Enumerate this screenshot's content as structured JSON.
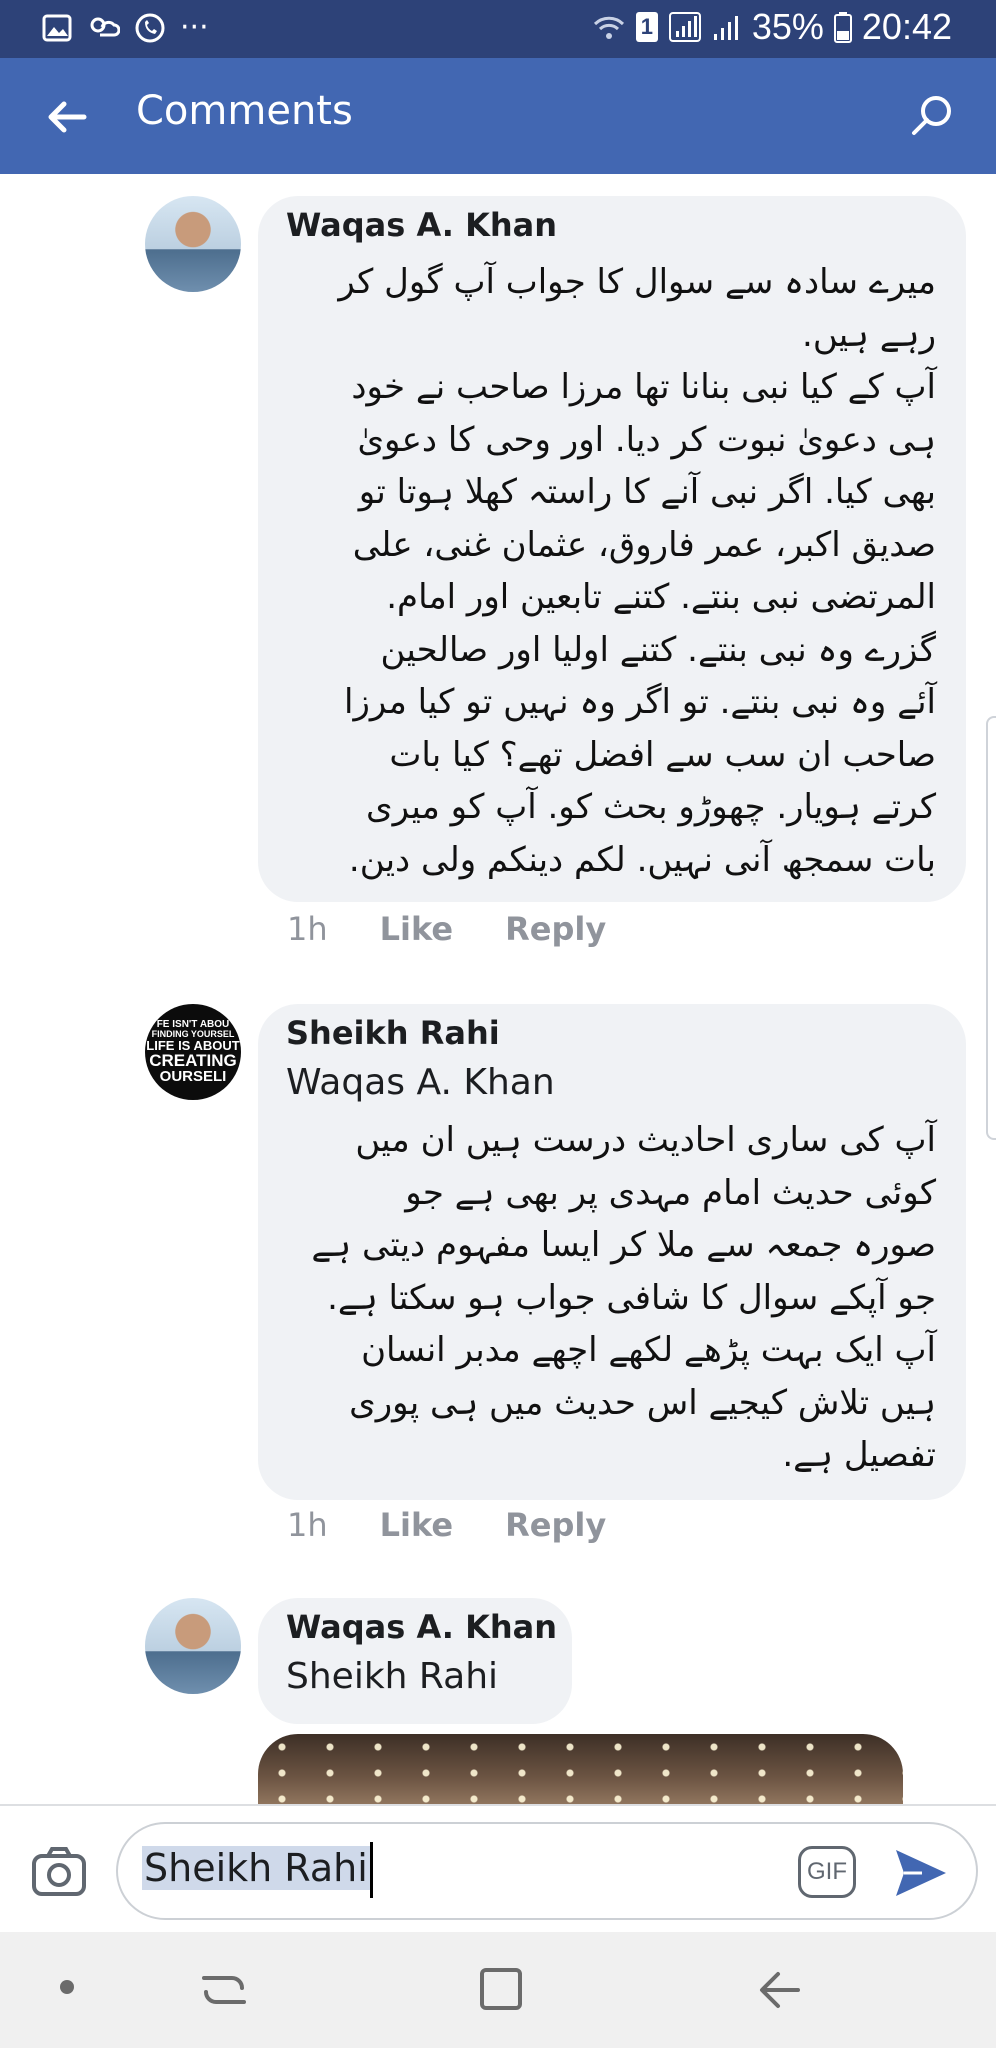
{
  "status_bar": {
    "sim_badge": "1",
    "battery": "35%",
    "time": "20:42",
    "left_icons": [
      "gallery-icon",
      "weather-icon",
      "call-icon",
      "more-dots-icon"
    ],
    "more": "···"
  },
  "app_bar": {
    "title": "Comments",
    "background": "#4267b2"
  },
  "comments": [
    {
      "author": "Waqas A. Khan",
      "avatar": "person-avatar",
      "lines": [
        "میرے سادہ سے سوال کا جواب آپ گول کر",
        "رہے ہیں.",
        "آپ کے کیا نبی بنانا تھا مرزا صاحب نے خود",
        "ہی دعویٰ نبوت کر دیا. اور وحی کا دعویٰ",
        "بھی کیا. اگر نبی آنے کا راستہ کھلا ہوتا تو",
        "صدیق اکبر، عمر فاروق، عثمان غنی، علی",
        "المرتضی نبی بنتے. کتنے تابعین اور امام.",
        "گزرے وہ نبی بنتے. کتنے اولیا اور صالحین",
        "آئے وہ نبی بنتے. تو اگر وہ نہیں تو کیا مرزا",
        "صاحب ان سب سے افضل تھے؟ کیا بات",
        "کرتے ہویار. چھوڑو بحث کو. آپ کو میری",
        "بات سمجھ آنی نہیں. لکم دینکم ولی دین."
      ],
      "time": "1h",
      "like": "Like",
      "reply": "Reply"
    },
    {
      "author": "Sheikh Rahi",
      "avatar_text": [
        "FE ISN'T ABOU",
        "FINDING YOURSEL",
        "LIFE IS ABOUT",
        "CREATING",
        "OURSELI"
      ],
      "mention": "Waqas A. Khan",
      "lines": [
        "آپ کی ساری احادیث درست ہیں ان میں",
        "کوئی حدیث امام مہدی پر بھی ہے جو",
        "صورہ جمعہ سے ملا کر ایسا مفہوم دیتی ہے",
        "جو آپکے سوال کا شافی جواب ہو سکتا ہے.",
        "آپ ایک بہت پڑھے لکھے اچھے مدبر انسان",
        "ہیں تلاش کیجیے اس حدیث میں ہی پوری",
        "تفصیل ہے."
      ],
      "time": "1h",
      "like": "Like",
      "reply": "Reply"
    },
    {
      "author": "Waqas A. Khan",
      "avatar": "person-avatar",
      "mention": "Sheikh Rahi"
    }
  ],
  "composer": {
    "value": "Sheikh Rahi",
    "gif_label": "GIF",
    "send_color": "#4267b2"
  }
}
